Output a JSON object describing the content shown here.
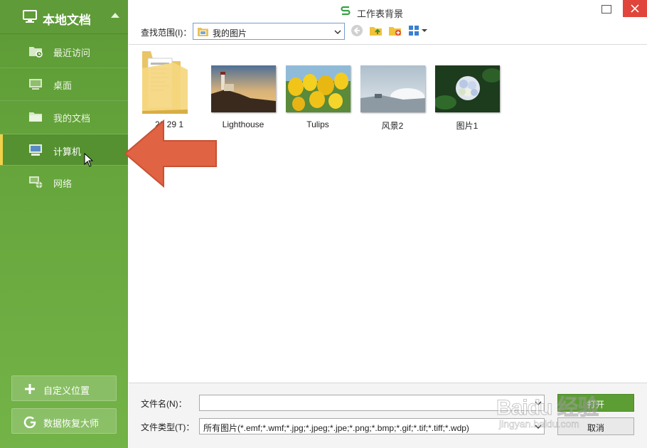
{
  "window": {
    "title": "工作表背景",
    "colors": {
      "sidebar": "#67a73d",
      "accent": "#5c9e33",
      "close": "#e0443a",
      "active_bar": "#f1d24a"
    }
  },
  "sidebar": {
    "header": {
      "title": "本地文档",
      "icon": "monitor-icon"
    },
    "items": [
      {
        "label": "最近访问",
        "icon": "recent-folder-icon",
        "active": false
      },
      {
        "label": "桌面",
        "icon": "desktop-icon",
        "active": false
      },
      {
        "label": "我的文档",
        "icon": "folder-icon",
        "active": false
      },
      {
        "label": "计算机",
        "icon": "computer-icon",
        "active": true
      },
      {
        "label": "网络",
        "icon": "network-icon",
        "active": false
      }
    ],
    "buttons": [
      {
        "label": "自定义位置",
        "icon": "plus-icon"
      },
      {
        "label": "数据恢复大师",
        "icon": "recover-icon"
      }
    ]
  },
  "toolbar": {
    "lookin_label": "查找范围(I)：",
    "lookin_value": "我的图片",
    "tools": [
      "back-icon",
      "up-folder-icon",
      "new-folder-icon",
      "view-menu-icon"
    ]
  },
  "files": [
    {
      "name": "20       29 1",
      "kind": "folder"
    },
    {
      "name": "Lighthouse",
      "kind": "image"
    },
    {
      "name": "Tulips",
      "kind": "image"
    },
    {
      "name": "风景2",
      "kind": "image"
    },
    {
      "name": "图片1",
      "kind": "image"
    }
  ],
  "footer": {
    "filename_label": "文件名(N)：",
    "filename_value": "",
    "filetype_label": "文件类型(T)：",
    "filetype_value": "所有图片(*.emf;*.wmf;*.jpg;*.jpeg;*.jpe;*.png;*.bmp;*.gif;*.tif;*.tiff;*.wdp)",
    "open_label": "打开",
    "cancel_label": "取消"
  },
  "watermark": {
    "main": "Baidu 经验",
    "sub": "jingyan.baidu.com"
  }
}
